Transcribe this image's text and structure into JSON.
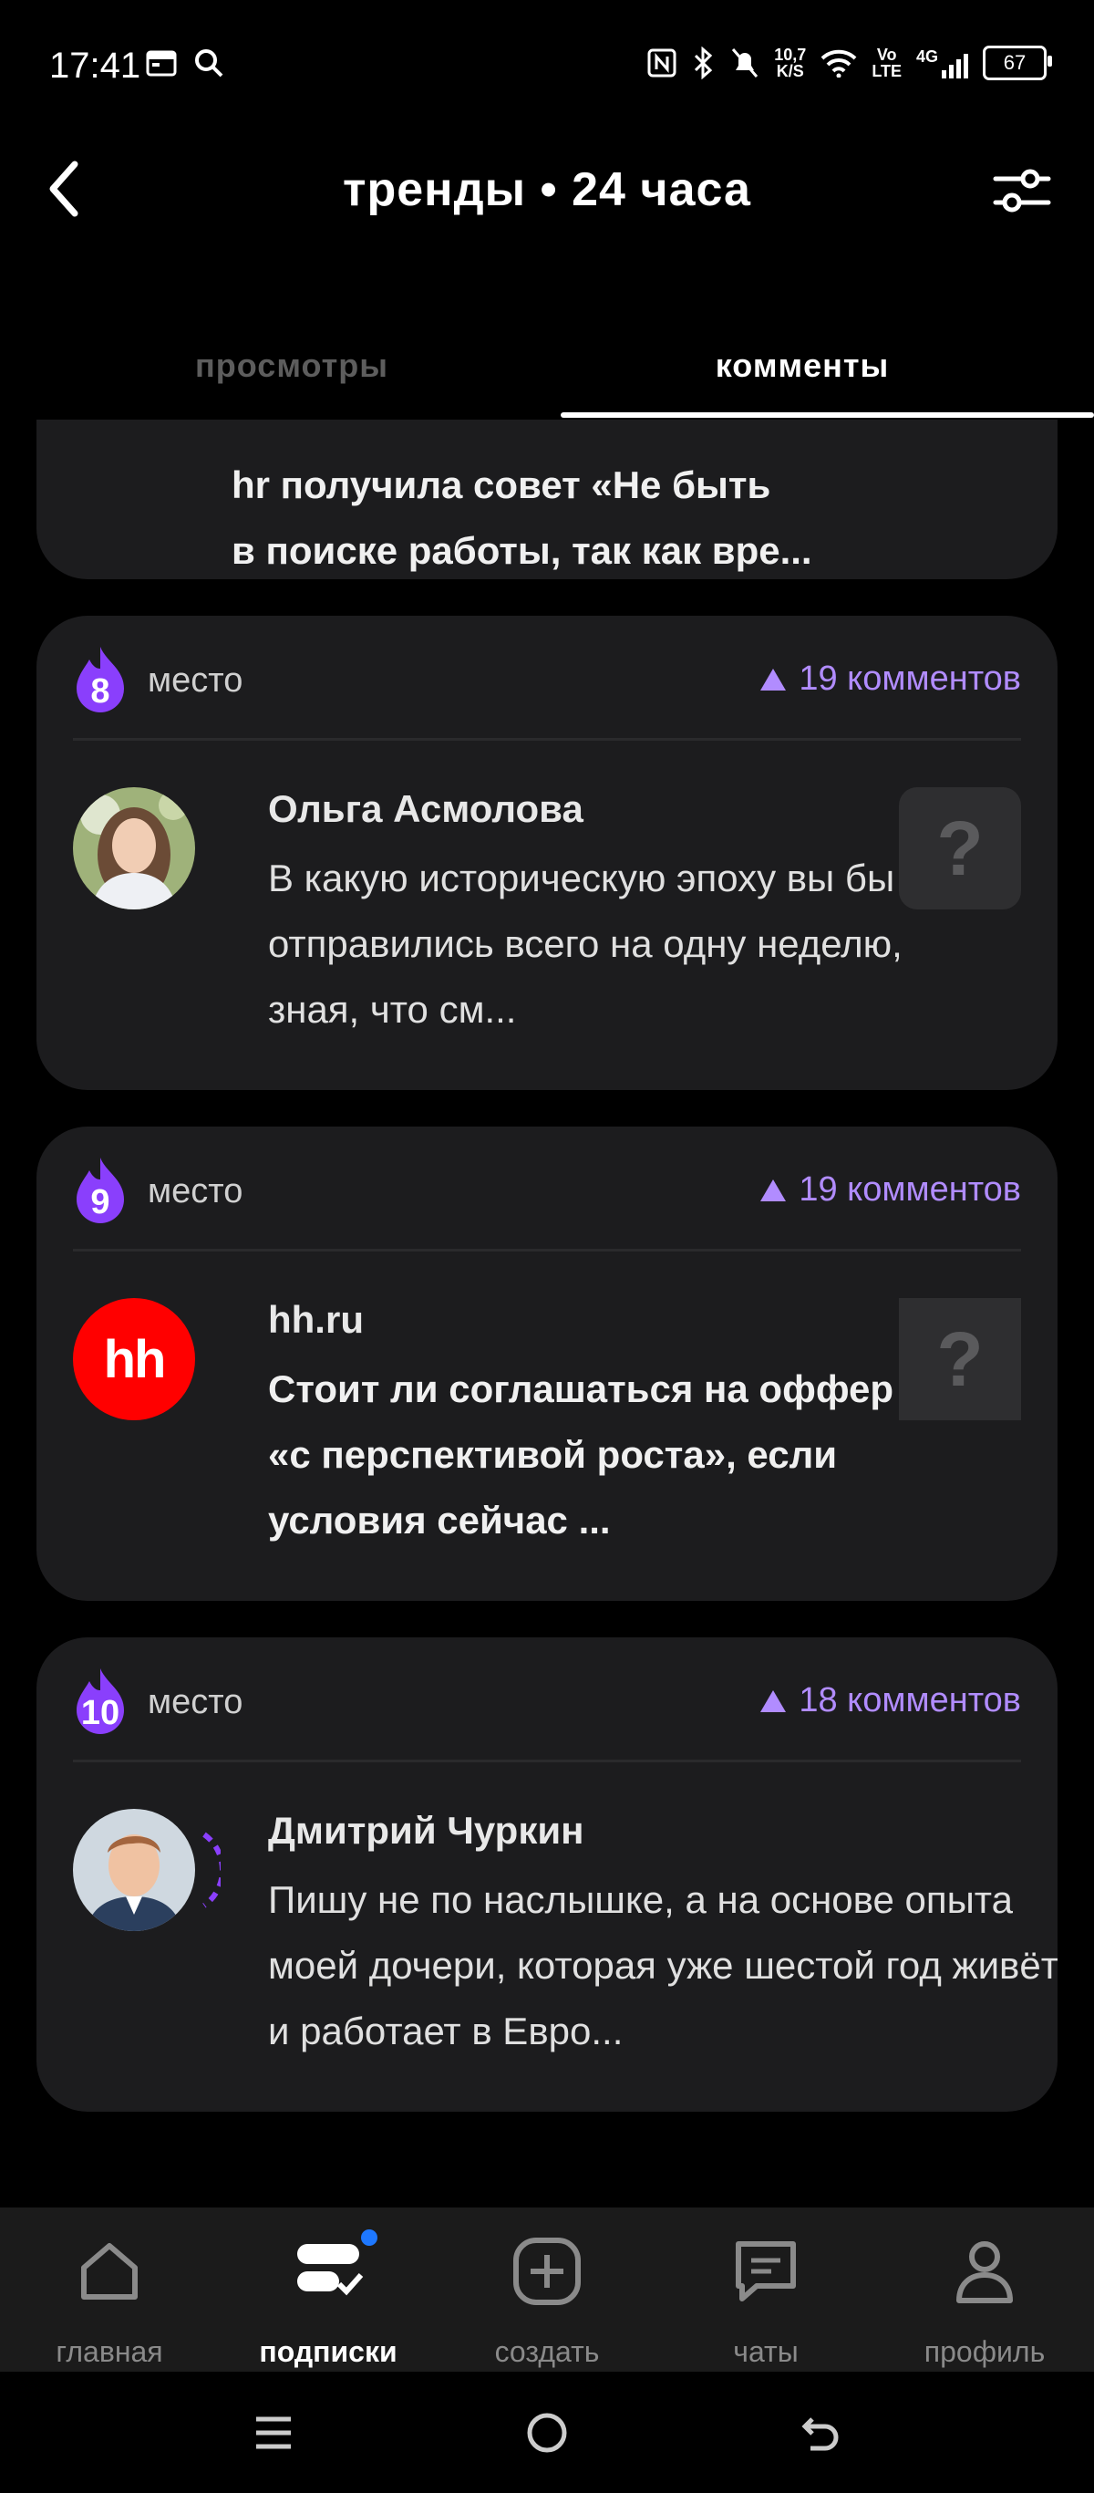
{
  "status_bar": {
    "time": "17:41",
    "net_speed_top": "10,7",
    "net_speed_bottom": "K/S",
    "volte_top": "Vo",
    "volte_bottom": "LTE",
    "network": "4G",
    "battery": "67"
  },
  "header": {
    "title": "тренды • 24 часа"
  },
  "tabs": [
    {
      "label": "просмотры",
      "active": false
    },
    {
      "label": "комменты",
      "active": true
    }
  ],
  "partial_card": {
    "text_line1": "hr получила совет «Не быть",
    "text_line2": "в поиске работы, так как вре..."
  },
  "cards": [
    {
      "rank": "8",
      "place_label": "место",
      "comments": "19 комментов",
      "author": "Ольга Асмолова",
      "text": "В какую историческую эпоху вы бы отправились всего на одну неделю, зная, что см...",
      "avatar_icon": "woman-portrait",
      "thumb": "?"
    },
    {
      "rank": "9",
      "place_label": "место",
      "comments": "19 комментов",
      "author": "hh.ru",
      "avatar_text": "hh",
      "text": "Стоит ли соглашаться на оффер «с перспективой роста», если условия сейчас ...",
      "thumb": "?"
    },
    {
      "rank": "10",
      "place_label": "место",
      "comments": "18 комментов",
      "author": "Дмитрий Чуркин",
      "text": "Пишу не по наслышке, а на основе опыта моей дочери, которая уже шестой год живёт и работает в Евро...",
      "avatar_icon": "man-portrait"
    }
  ],
  "nav": [
    {
      "label": "главная",
      "icon": "home-icon",
      "active": false
    },
    {
      "label": "подписки",
      "icon": "subscriptions-icon",
      "active": true,
      "badge": true
    },
    {
      "label": "создать",
      "icon": "create-plus-icon",
      "active": false
    },
    {
      "label": "чаты",
      "icon": "chat-icon",
      "active": false
    },
    {
      "label": "профиль",
      "icon": "profile-icon",
      "active": false
    }
  ],
  "colors": {
    "accent": "#b18cff",
    "flame": "#8a3ffc",
    "card_bg": "#1c1c1e",
    "hh_red": "#ff0000",
    "badge_blue": "#1e78ff"
  }
}
